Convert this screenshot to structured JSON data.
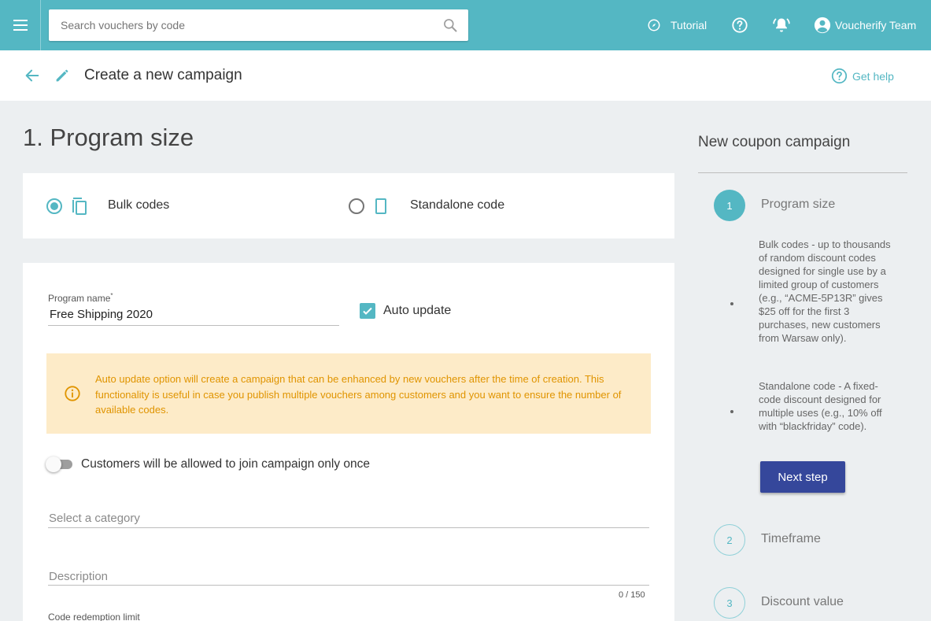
{
  "topbar": {
    "search_placeholder": "Search vouchers by code",
    "tutorial_label": "Tutorial",
    "user_label": "Voucherify Team"
  },
  "header": {
    "title": "Create a new campaign",
    "help_label": "Get help"
  },
  "main": {
    "heading": "1. Program size",
    "code_type": {
      "options": [
        {
          "label": "Bulk codes",
          "selected": true
        },
        {
          "label": "Standalone code",
          "selected": false
        }
      ]
    },
    "program_name": {
      "label": "Program name",
      "required_mark": "*",
      "value": "Free Shipping 2020"
    },
    "auto_update": {
      "label": "Auto update",
      "checked": true
    },
    "alert_text": "Auto update option will create a campaign that can be enhanced by new vouchers after the time of creation. This functionality is useful in case you publish multiple vouchers among customers and you want to ensure the number of available codes.",
    "join_once": {
      "label": "Customers will be allowed to join campaign only once",
      "enabled": false
    },
    "category_placeholder": "Select a category",
    "description_placeholder": "Description",
    "description_counter": "0 / 150",
    "redemption_limit_label": "Code redemption limit"
  },
  "sidebar": {
    "title": "New coupon campaign",
    "steps": [
      {
        "number": "1",
        "label": "Program size",
        "active": true
      },
      {
        "number": "2",
        "label": "Timeframe",
        "active": false
      },
      {
        "number": "3",
        "label": "Discount value",
        "active": false
      }
    ],
    "desc_bulk": "Bulk codes - up to thousands of random discount codes designed for single use by a limited group of customers (e.g., “ACME-5P13R” gives $25 off for the first 3 purchases, new customers from Warsaw only).",
    "desc_standalone": "Standalone code - A fixed-code discount designed for multiple uses (e.g., 10% off with “blackfriday” code).",
    "next_button": "Next step"
  },
  "colors": {
    "primary": "#54b7c3",
    "button": "#35479b",
    "alert_bg": "#fdebc8",
    "alert_text": "#e09400"
  }
}
